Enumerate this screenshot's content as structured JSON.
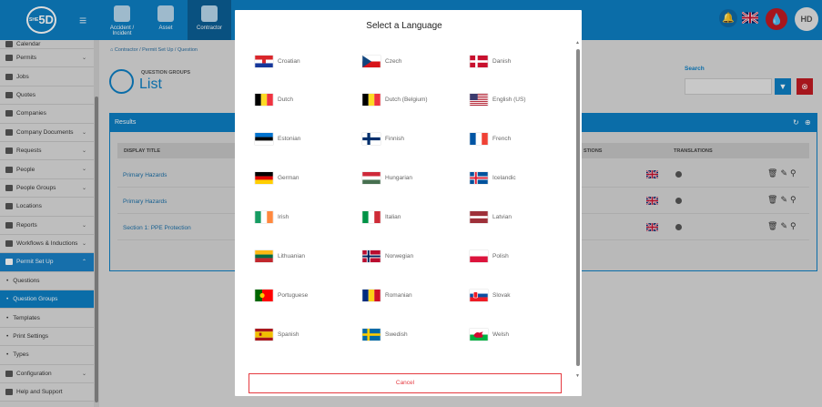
{
  "topbar": {
    "logo_text": "5D",
    "logo_prefix": "SHE",
    "nav": [
      {
        "label": "Accident / Incident"
      },
      {
        "label": "Asset"
      },
      {
        "label": "Contractor"
      }
    ],
    "user_initials": "HD"
  },
  "sidebar": {
    "items": [
      {
        "label": "Calendar"
      },
      {
        "label": "Permits"
      },
      {
        "label": "Jobs"
      },
      {
        "label": "Quotes"
      },
      {
        "label": "Companies"
      },
      {
        "label": "Company Documents"
      },
      {
        "label": "Requests"
      },
      {
        "label": "People"
      },
      {
        "label": "People Groups"
      },
      {
        "label": "Locations"
      },
      {
        "label": "Reports"
      },
      {
        "label": "Workflows & Inductions"
      },
      {
        "label": "Permit Set Up"
      }
    ],
    "sub_items": [
      {
        "label": "Questions"
      },
      {
        "label": "Question Groups"
      },
      {
        "label": "Templates"
      },
      {
        "label": "Print Settings"
      },
      {
        "label": "Types"
      }
    ],
    "bottom_items": [
      {
        "label": "Configuration"
      },
      {
        "label": "Help and Support"
      }
    ]
  },
  "page": {
    "breadcrumb": [
      "Contractor",
      "Permit Set Up",
      "Question"
    ],
    "subtitle": "QUESTION GROUPS",
    "title": "List",
    "search_label": "Search",
    "results_label": "Results",
    "columns": {
      "display_title": "DISPLAY TITLE",
      "questions": "STIONS",
      "translations": "TRANSLATIONS"
    },
    "rows": [
      {
        "title": "Primary Hazards"
      },
      {
        "title": "Primary Hazards"
      },
      {
        "title": "Section 1: PPE Protection"
      }
    ]
  },
  "modal": {
    "title": "Select a Language",
    "languages": [
      {
        "name": "Croatian",
        "flag": "croatia"
      },
      {
        "name": "Czech",
        "flag": "czech"
      },
      {
        "name": "Danish",
        "flag": "denmark"
      },
      {
        "name": "Dutch",
        "flag": "belgium"
      },
      {
        "name": "Dutch (Belgium)",
        "flag": "belgium"
      },
      {
        "name": "English (US)",
        "flag": "usa"
      },
      {
        "name": "Estonian",
        "flag": "estonia"
      },
      {
        "name": "Finnish",
        "flag": "finland"
      },
      {
        "name": "French",
        "flag": "france"
      },
      {
        "name": "German",
        "flag": "germany"
      },
      {
        "name": "Hungarian",
        "flag": "hungary"
      },
      {
        "name": "Icelandic",
        "flag": "iceland"
      },
      {
        "name": "Irish",
        "flag": "ireland"
      },
      {
        "name": "Italian",
        "flag": "italy"
      },
      {
        "name": "Latvian",
        "flag": "latvia"
      },
      {
        "name": "Lithuanian",
        "flag": "lithuania"
      },
      {
        "name": "Norwegian",
        "flag": "norway"
      },
      {
        "name": "Polish",
        "flag": "poland"
      },
      {
        "name": "Portuguese",
        "flag": "portugal"
      },
      {
        "name": "Romanian",
        "flag": "romania"
      },
      {
        "name": "Slovak",
        "flag": "slovakia"
      },
      {
        "name": "Spanish",
        "flag": "spain"
      },
      {
        "name": "Swedish",
        "flag": "sweden"
      },
      {
        "name": "Welsh",
        "flag": "wales"
      }
    ],
    "cancel_label": "Cancel"
  },
  "colors": {
    "brand_blue": "#0d7fc4",
    "danger_red": "#c21a22",
    "cancel_red": "#e53a40"
  }
}
